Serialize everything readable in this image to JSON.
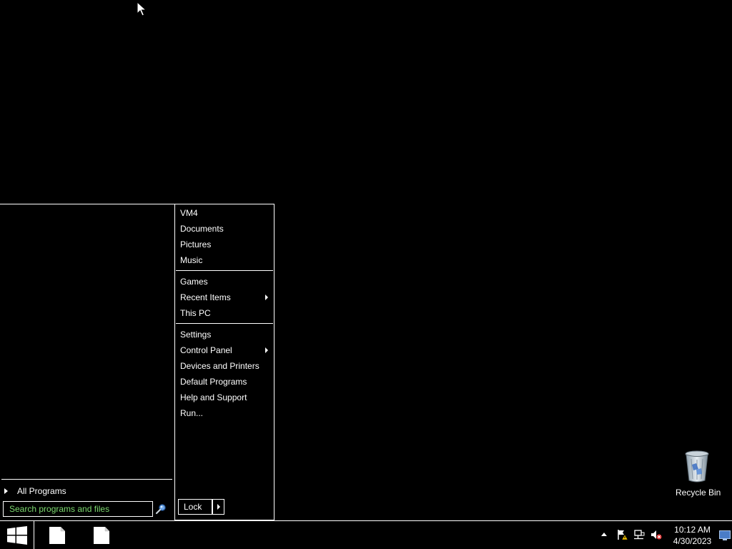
{
  "desktop": {
    "recycle_bin": {
      "label": "Recycle Bin",
      "icon": "recycle-bin-icon"
    }
  },
  "start_menu": {
    "right_groups": [
      [
        {
          "label": "VM4"
        },
        {
          "label": "Documents"
        },
        {
          "label": "Pictures"
        },
        {
          "label": "Music"
        }
      ],
      [
        {
          "label": "Games"
        },
        {
          "label": "Recent Items",
          "submenu": true
        },
        {
          "label": "This PC"
        }
      ],
      [
        {
          "label": "Settings"
        },
        {
          "label": "Control Panel",
          "submenu": true
        },
        {
          "label": "Devices and Printers"
        },
        {
          "label": "Default Programs"
        },
        {
          "label": "Help and Support"
        },
        {
          "label": "Run..."
        }
      ]
    ],
    "all_programs": "All Programs",
    "search": {
      "placeholder": "Search programs and files",
      "value": ""
    },
    "lock": "Lock"
  },
  "taskbar": {
    "apps": [
      {
        "icon": "document-icon"
      },
      {
        "icon": "document-icon"
      }
    ],
    "tray_icons": [
      "action-center-flag-icon",
      "network-icon",
      "volume-muted-icon"
    ],
    "clock": {
      "time": "10:12 AM",
      "date": "4/30/2023"
    }
  },
  "colors": {
    "background": "#000000",
    "foreground": "#ffffff",
    "search_placeholder": "#7dd96f"
  }
}
